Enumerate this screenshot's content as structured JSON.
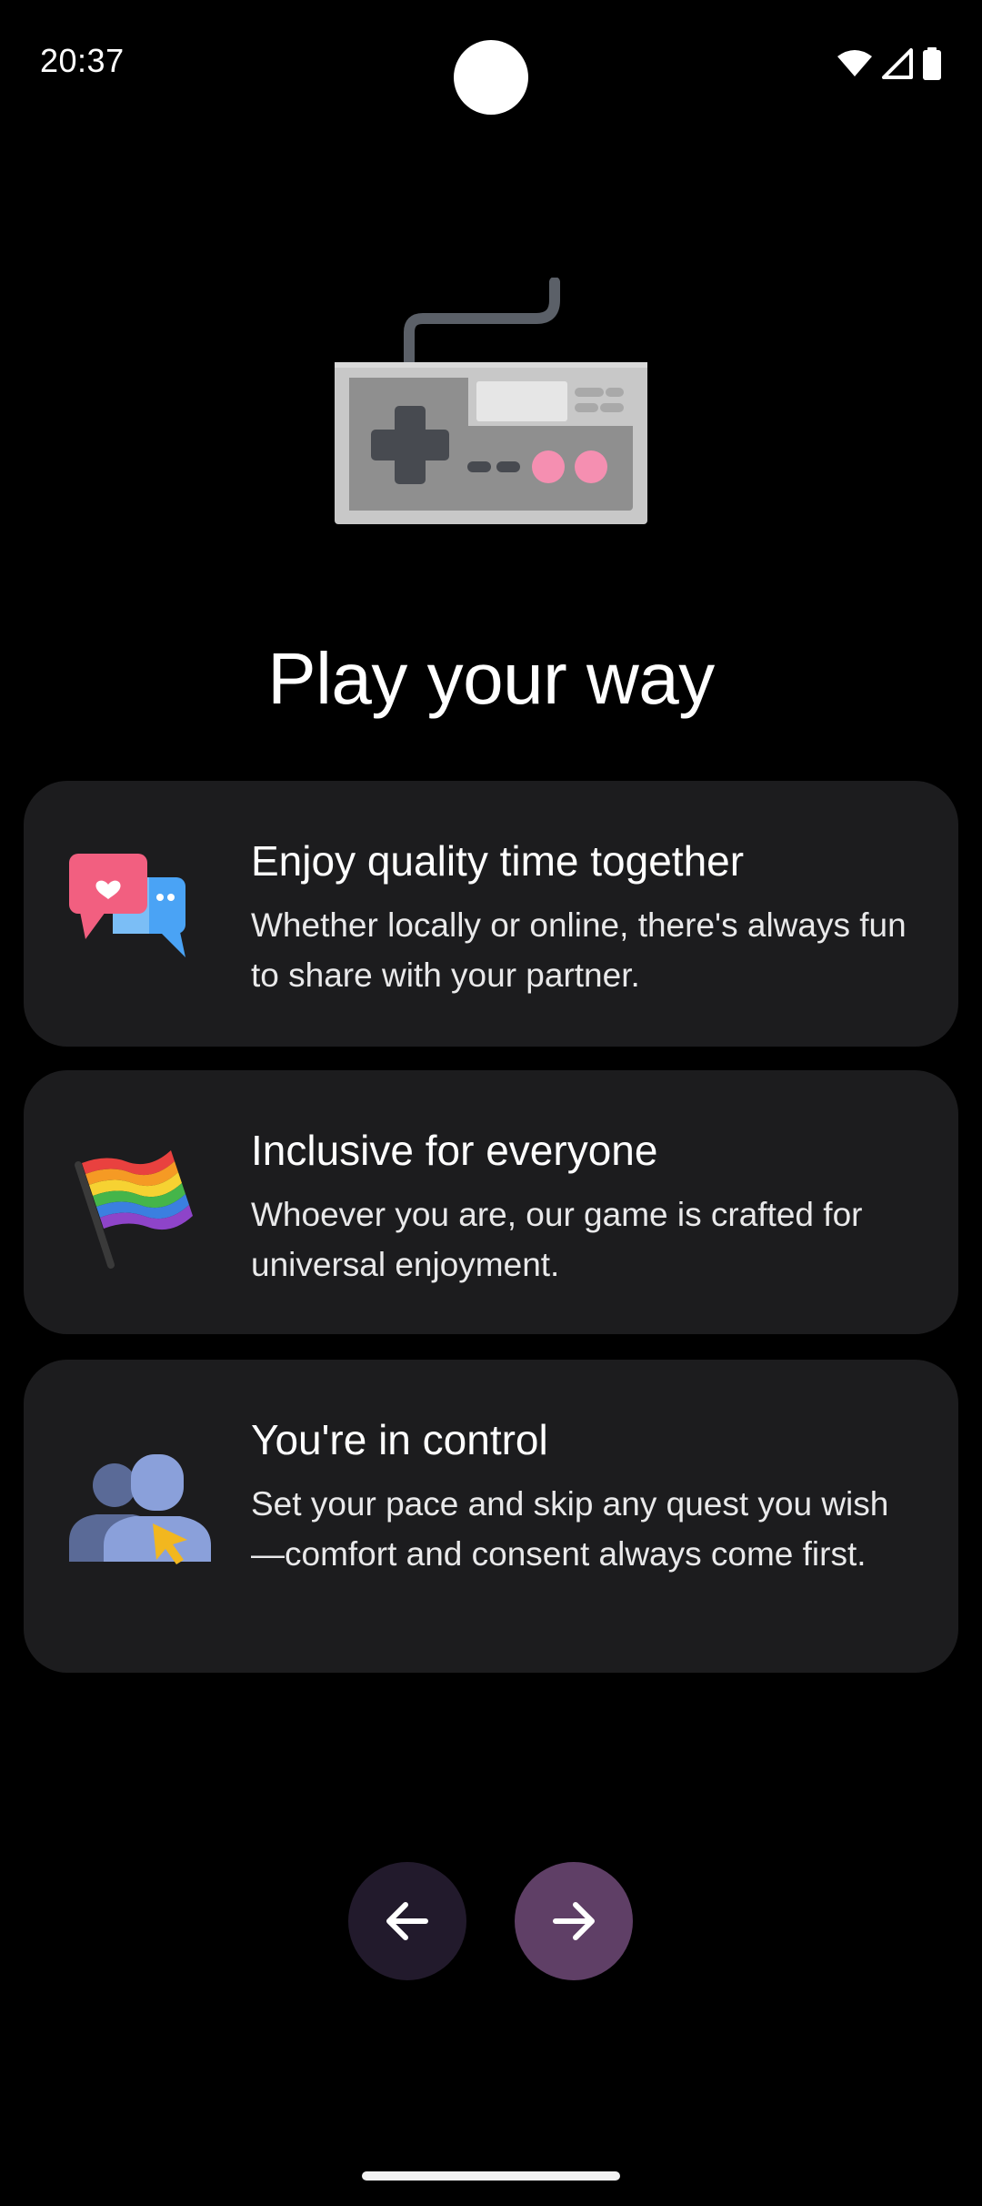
{
  "status_bar": {
    "time": "20:37",
    "icons": [
      "wifi-icon",
      "cell-signal-icon",
      "battery-icon"
    ]
  },
  "hero": {
    "icon": "game-controller-icon"
  },
  "page": {
    "title": "Play your way"
  },
  "features": [
    {
      "icon": "chat-bubbles-heart-icon",
      "title": "Enjoy quality time together",
      "body": "Whether locally or online, there's always fun to share with your partner."
    },
    {
      "icon": "rainbow-flag-icon",
      "title": "Inclusive for everyone",
      "body": "Whoever you are, our game is crafted for universal enjoyment."
    },
    {
      "icon": "users-cursor-icon",
      "title": "You're in control",
      "body": "Set your pace and skip any quest you wish—comfort and consent always come first."
    }
  ],
  "navigation": {
    "back_icon": "arrow-left-icon",
    "next_icon": "arrow-right-icon"
  },
  "colors": {
    "background": "#000000",
    "card": "#1c1c1e",
    "back_button": "#221a2c",
    "next_button": "#5f3f66",
    "text": "#ffffff"
  }
}
